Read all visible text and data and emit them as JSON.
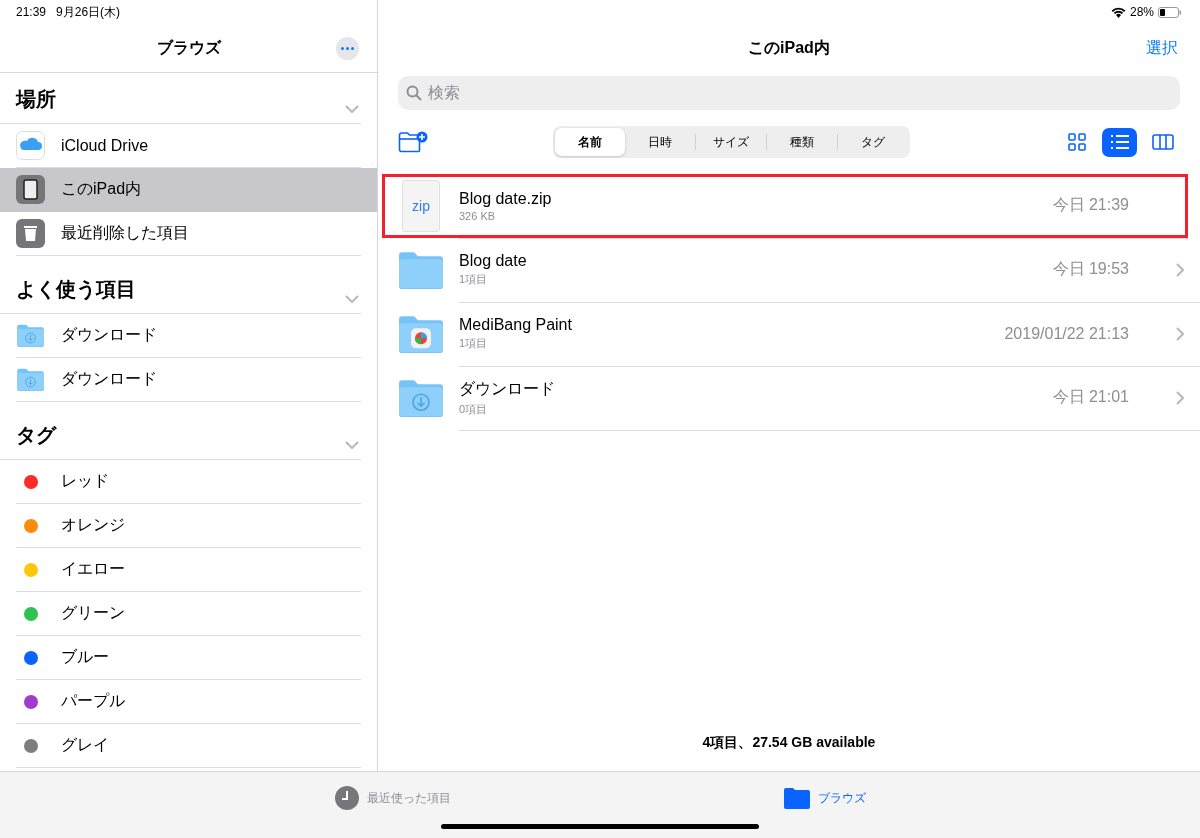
{
  "status_bar": {
    "time": "21:39",
    "date": "9月26日(木)",
    "battery": "28%"
  },
  "sidebar": {
    "title": "ブラウズ",
    "sections": [
      {
        "title": "場所",
        "expanded": true,
        "items": [
          {
            "label": "iCloud Drive",
            "kind": "cloud",
            "selected": false
          },
          {
            "label": "このiPad内",
            "kind": "ipad",
            "selected": true
          },
          {
            "label": "最近削除した項目",
            "kind": "trash",
            "selected": false
          }
        ]
      },
      {
        "title": "よく使う項目",
        "expanded": true,
        "items": [
          {
            "label": "ダウンロード",
            "kind": "download-folder",
            "selected": false
          },
          {
            "label": "ダウンロード",
            "kind": "download-folder",
            "selected": false
          }
        ]
      },
      {
        "title": "タグ",
        "expanded": true,
        "items": [
          {
            "label": "レッド",
            "kind": "tag",
            "color": "#fe2b26",
            "selected": false
          },
          {
            "label": "オレンジ",
            "kind": "tag",
            "color": "#fe8a0b",
            "selected": false
          },
          {
            "label": "イエロー",
            "kind": "tag",
            "color": "#fec80a",
            "selected": false
          },
          {
            "label": "グリーン",
            "kind": "tag",
            "color": "#2fc151",
            "selected": false
          },
          {
            "label": "ブルー",
            "kind": "tag",
            "color": "#0a63fe",
            "selected": false
          },
          {
            "label": "パープル",
            "kind": "tag",
            "color": "#a33ad0",
            "selected": false
          },
          {
            "label": "グレイ",
            "kind": "tag",
            "color": "#7d7d80",
            "selected": false
          }
        ]
      }
    ]
  },
  "main": {
    "title": "このiPad内",
    "select_label": "選択",
    "search": {
      "placeholder": "検索"
    },
    "sort": [
      {
        "label": "名前",
        "selected": true
      },
      {
        "label": "日時",
        "selected": false
      },
      {
        "label": "サイズ",
        "selected": false
      },
      {
        "label": "種類",
        "selected": false
      },
      {
        "label": "タグ",
        "selected": false
      }
    ],
    "views": [
      {
        "kind": "grid",
        "selected": false
      },
      {
        "kind": "list",
        "selected": true
      },
      {
        "kind": "columns",
        "selected": false
      }
    ],
    "files": [
      {
        "name": "Blog date.zip",
        "detail": "326 KB",
        "date": "今日 21:39",
        "kind": "zip",
        "icon_label": "zip",
        "highlighted": true
      },
      {
        "name": "Blog date",
        "detail": "1項目",
        "date": "今日 19:53",
        "kind": "folder",
        "highlighted": false
      },
      {
        "name": "MediBang Paint",
        "detail": "1項目",
        "date": "2019/01/22 21:13",
        "kind": "app-folder",
        "highlighted": false
      },
      {
        "name": "ダウンロード",
        "detail": "0項目",
        "date": "今日 21:01",
        "kind": "download-folder",
        "highlighted": false
      }
    ],
    "footer": "4項目、27.54 GB available"
  },
  "tab_bar": [
    {
      "label": "最近使った項目",
      "kind": "recent",
      "selected": false
    },
    {
      "label": "ブラウズ",
      "kind": "browse",
      "selected": true
    }
  ]
}
